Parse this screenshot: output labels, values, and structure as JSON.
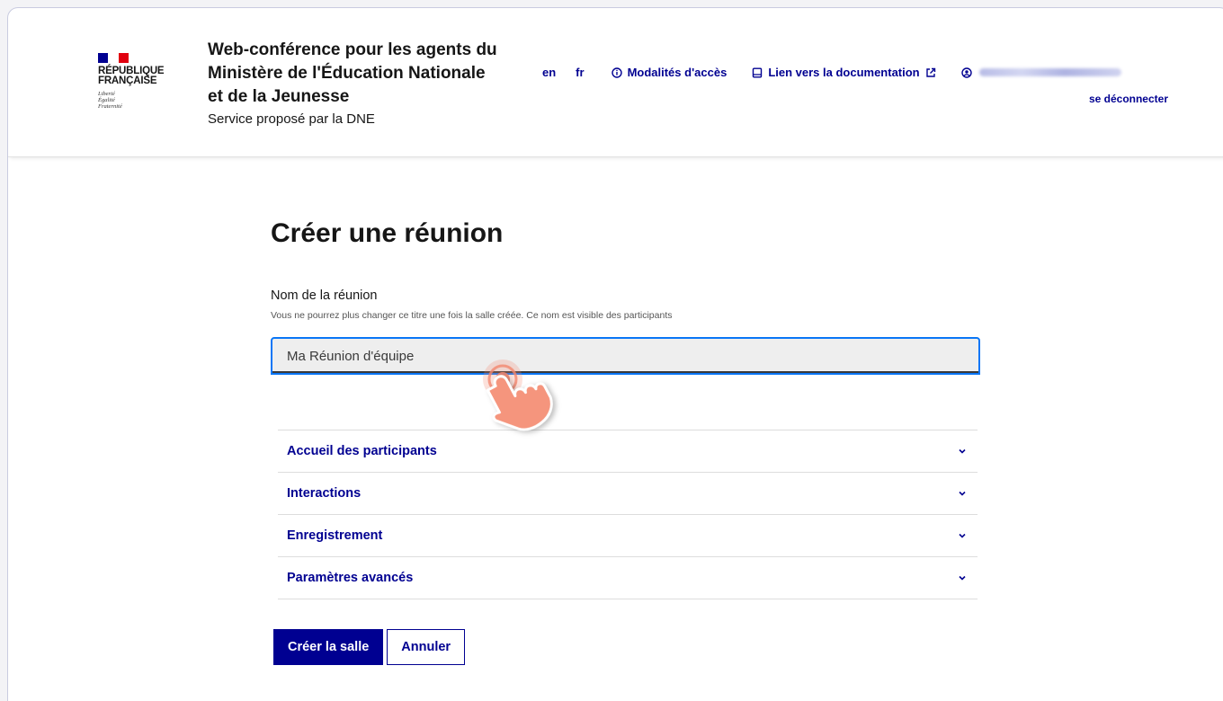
{
  "header": {
    "logo": {
      "name_line1": "RÉPUBLIQUE",
      "name_line2": "FRANÇAISE",
      "motto": [
        "Liberté",
        "Égalité",
        "Fraternité"
      ],
      "colors": {
        "blue": "#000091",
        "red": "#e1000f"
      }
    },
    "service_title": "Web-conférence pour les agents du Ministère de l'Éducation Nationale et de la Jeunesse",
    "service_tagline": "Service proposé par la DNE",
    "nav": {
      "lang_en": "en",
      "lang_fr": "fr",
      "access_label": "Modalités d'accès",
      "access_icon": "info-circle-icon",
      "docs_label": "Lien vers la documentation",
      "docs_icon": "book-icon",
      "external_icon": "external-link-icon",
      "user_icon": "user-circle-icon"
    },
    "logout_label": "se déconnecter"
  },
  "main": {
    "title": "Créer une réunion",
    "name_field": {
      "label": "Nom de la réunion",
      "hint": "Vous ne pourrez plus changer ce titre une fois la salle créée. Ce nom est visible des participants",
      "value": "Ma Réunion d'équipe"
    },
    "sections": [
      {
        "label": "Accueil des participants"
      },
      {
        "label": "Interactions"
      },
      {
        "label": "Enregistrement"
      },
      {
        "label": "Paramètres avancés"
      }
    ],
    "create_button": "Créer la salle",
    "cancel_button": "Annuler"
  },
  "colors": {
    "primary": "#000091",
    "focus": "#0a76f6",
    "pointer": "#f2876f"
  }
}
